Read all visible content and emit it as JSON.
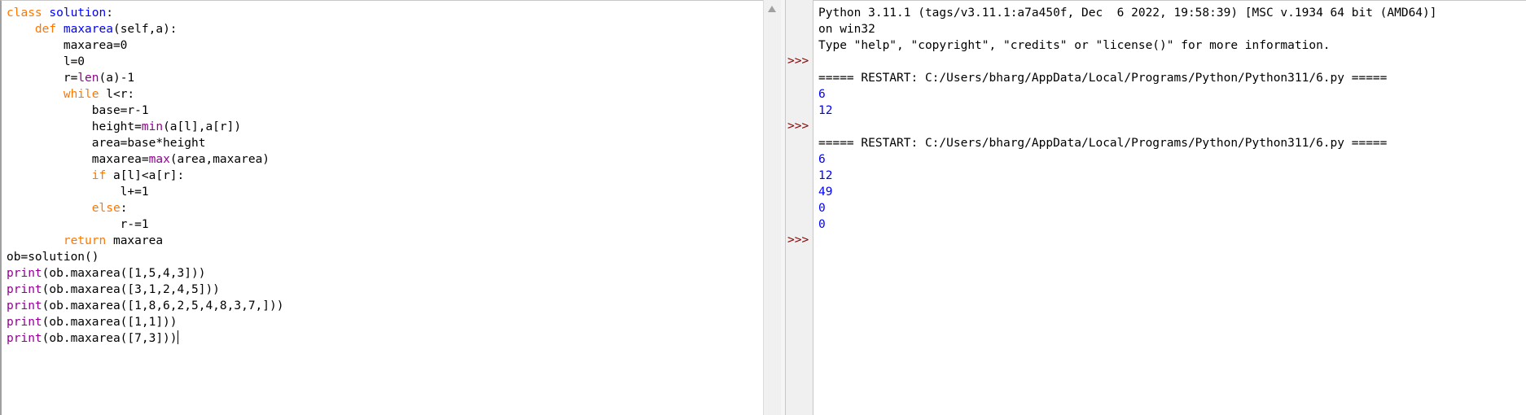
{
  "editor": {
    "lines": [
      [
        [
          "kw",
          "class"
        ],
        [
          "plain",
          " "
        ],
        [
          "def",
          "solution"
        ],
        [
          "plain",
          ":"
        ]
      ],
      [
        [
          "plain",
          "    "
        ],
        [
          "kw",
          "def"
        ],
        [
          "plain",
          " "
        ],
        [
          "def",
          "maxarea"
        ],
        [
          "plain",
          "(self,a):"
        ]
      ],
      [
        [
          "plain",
          "        maxarea=0"
        ]
      ],
      [
        [
          "plain",
          "        l=0"
        ]
      ],
      [
        [
          "plain",
          "        r="
        ],
        [
          "bi",
          "len"
        ],
        [
          "plain",
          "(a)-1"
        ]
      ],
      [
        [
          "plain",
          "        "
        ],
        [
          "kw",
          "while"
        ],
        [
          "plain",
          " l<r:"
        ]
      ],
      [
        [
          "plain",
          "            base=r-1"
        ]
      ],
      [
        [
          "plain",
          "            height="
        ],
        [
          "bi",
          "min"
        ],
        [
          "plain",
          "(a[l],a[r])"
        ]
      ],
      [
        [
          "plain",
          "            area=base*height"
        ]
      ],
      [
        [
          "plain",
          "            maxarea="
        ],
        [
          "bi",
          "max"
        ],
        [
          "plain",
          "(area,maxarea)"
        ]
      ],
      [
        [
          "plain",
          "            "
        ],
        [
          "kw",
          "if"
        ],
        [
          "plain",
          " a[l]<a[r]:"
        ]
      ],
      [
        [
          "plain",
          "                l+=1"
        ]
      ],
      [
        [
          "plain",
          "            "
        ],
        [
          "kw",
          "else"
        ],
        [
          "plain",
          ":"
        ]
      ],
      [
        [
          "plain",
          "                r-=1"
        ]
      ],
      [
        [
          "plain",
          "        "
        ],
        [
          "kw",
          "return"
        ],
        [
          "plain",
          " maxarea"
        ]
      ],
      [
        [
          "plain",
          "ob=solution()"
        ]
      ],
      [
        [
          "bi",
          "print"
        ],
        [
          "plain",
          "(ob.maxarea([1,5,4,3]))"
        ]
      ],
      [
        [
          "bi",
          "print"
        ],
        [
          "plain",
          "(ob.maxarea([3,1,2,4,5]))"
        ]
      ],
      [
        [
          "bi",
          "print"
        ],
        [
          "plain",
          "(ob.maxarea([1,8,6,2,5,4,8,3,7,]))"
        ]
      ],
      [
        [
          "bi",
          "print"
        ],
        [
          "plain",
          "(ob.maxarea([1,1]))"
        ]
      ],
      [
        [
          "bi",
          "print"
        ],
        [
          "plain",
          "(ob.maxarea([7,3]))"
        ]
      ]
    ]
  },
  "shell": {
    "prompt": ">>>",
    "lines": [
      {
        "cls": "plain",
        "text": "Python 3.11.1 (tags/v3.11.1:a7a450f, Dec  6 2022, 19:58:39) [MSC v.1934 64 bit (AMD64)]"
      },
      {
        "cls": "plain",
        "text": "on win32"
      },
      {
        "cls": "plain",
        "text": "Type \"help\", \"copyright\", \"credits\" or \"license()\" for more information."
      },
      {
        "cls": "plain",
        "text": "",
        "prompt": true
      },
      {
        "cls": "plain",
        "text": "===== RESTART: C:/Users/bharg/AppData/Local/Programs/Python/Python311/6.py ====="
      },
      {
        "cls": "out",
        "text": "6"
      },
      {
        "cls": "out",
        "text": "12"
      },
      {
        "cls": "plain",
        "text": "",
        "prompt": true
      },
      {
        "cls": "plain",
        "text": "===== RESTART: C:/Users/bharg/AppData/Local/Programs/Python/Python311/6.py ====="
      },
      {
        "cls": "out",
        "text": "6"
      },
      {
        "cls": "out",
        "text": "12"
      },
      {
        "cls": "out",
        "text": "49"
      },
      {
        "cls": "out",
        "text": "0"
      },
      {
        "cls": "out",
        "text": "0"
      },
      {
        "cls": "plain",
        "text": "",
        "prompt": true
      }
    ]
  },
  "colors": {
    "keyword": "#ff7700",
    "definition": "#0000ff",
    "builtin": "#900090",
    "output": "#0000ff",
    "prompt": "#8b0000"
  }
}
